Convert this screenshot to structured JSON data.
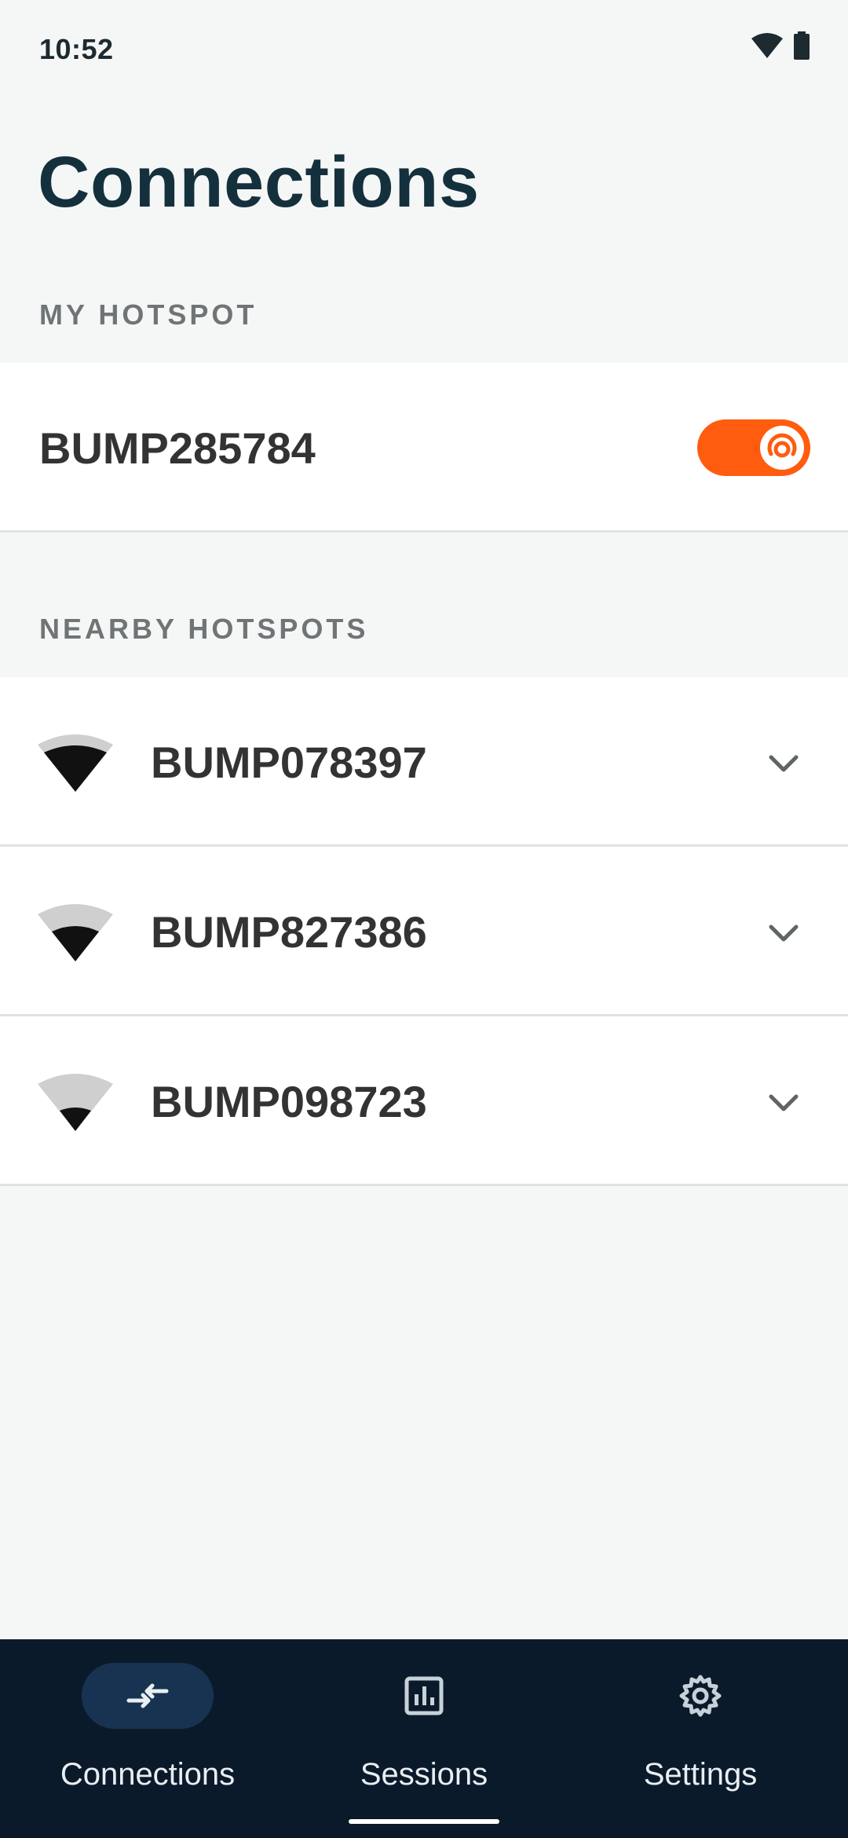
{
  "status_bar": {
    "time": "10:52",
    "icons": [
      "wifi-icon",
      "battery-icon"
    ]
  },
  "page": {
    "title": "Connections"
  },
  "my_hotspot": {
    "section_label": "MY HOTSPOT",
    "name": "BUMP285784",
    "toggle_on": true,
    "toggle_color": "#ff5c0f"
  },
  "nearby": {
    "section_label": "NEARBY HOTSPOTS",
    "hotspots": [
      {
        "name": "BUMP078397",
        "signal_level": 3,
        "icon": "wifi-signal-icon"
      },
      {
        "name": "BUMP827386",
        "signal_level": 2,
        "icon": "wifi-signal-icon"
      },
      {
        "name": "BUMP098723",
        "signal_level": 1,
        "icon": "wifi-signal-icon"
      }
    ]
  },
  "bottom_nav": {
    "items": [
      {
        "label": "Connections",
        "icon": "connections-icon",
        "selected": true
      },
      {
        "label": "Sessions",
        "icon": "bar-chart-icon",
        "selected": false
      },
      {
        "label": "Settings",
        "icon": "gear-icon",
        "selected": false
      }
    ]
  },
  "colors": {
    "accent": "#ff5c0f",
    "nav_background": "#0b1a2b",
    "title": "#15303d"
  }
}
